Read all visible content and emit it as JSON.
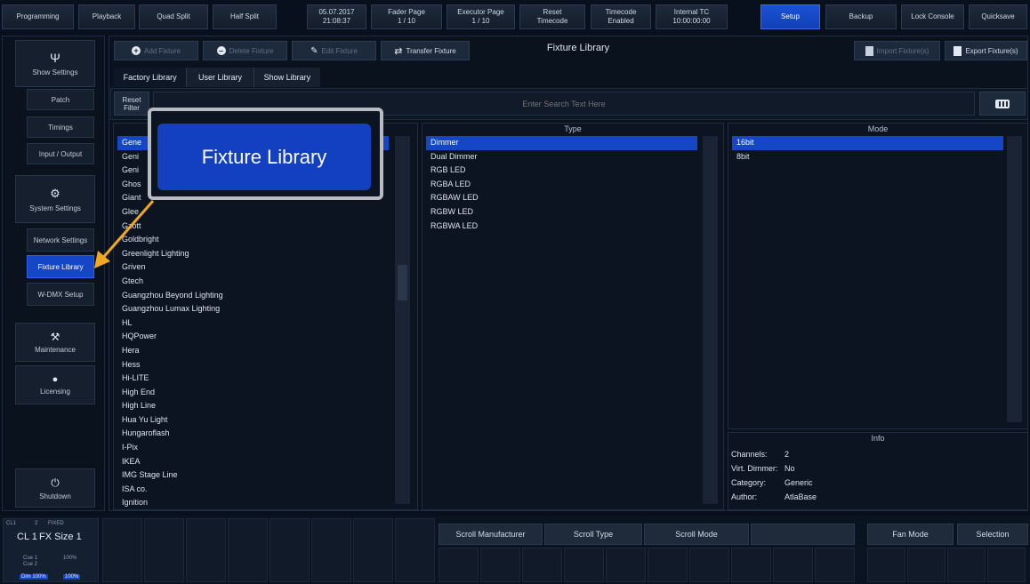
{
  "top_bar": {
    "programming": "Programming",
    "playback": "Playback",
    "quad_split": "Quad Split",
    "half_split": "Half Split",
    "date": "05.07.2017",
    "time": "21:08:37",
    "fader_page_label": "Fader Page",
    "fader_page_value": "1 / 10",
    "executor_page_label": "Executor Page",
    "executor_page_value": "1 / 10",
    "reset_label": "Reset",
    "reset_sub": "Timecode",
    "timecode_label": "Timecode",
    "timecode_sub": "Enabled",
    "internal_tc_label": "Internal TC",
    "internal_tc_value": "10:00:00:00",
    "setup": "Setup",
    "backup": "Backup",
    "lock_console": "Lock Console",
    "quicksave": "Quicksave"
  },
  "sidebar": {
    "show_settings": "Show Settings",
    "patch": "Patch",
    "timings": "Timings",
    "input_output": "Input / Output",
    "system_settings": "System Settings",
    "network_settings": "Network Settings",
    "fixture_library": "Fixture Library",
    "wdmx_setup": "W-DMX Setup",
    "maintenance": "Maintenance",
    "licensing": "Licensing",
    "shutdown": "Shutdown"
  },
  "toolbar": {
    "add_fixture": "Add Fixture",
    "delete_fixture": "Delete Fixture",
    "edit_fixture": "Edit Fixture",
    "transfer_fixture": "Transfer Fixture",
    "title": "Fixture Library",
    "import_fixtures": "Import Fixture(s)",
    "export_fixtures": "Export Fixture(s)"
  },
  "tabs": [
    "Factory Library",
    "User Library",
    "Show Library"
  ],
  "search": {
    "reset_filter_line1": "Reset",
    "reset_filter_line2": "Filter",
    "placeholder": "Enter Search Text Here"
  },
  "callout": {
    "label": "Fixture Library"
  },
  "manufacturers": [
    "Gene",
    "Geni",
    "Geni",
    "Ghos",
    "Giant",
    "Glee",
    "Gzott",
    "Goldbright",
    "Greenlight Lighting",
    "Griven",
    "Gtech",
    "Guangzhou Beyond Lighting",
    "Guangzhou Lumax Lighting",
    "HL",
    "HQPower",
    "Hera",
    "Hess",
    "Hi-LITE",
    "High End",
    "High Line",
    "Hua Yu Light",
    "Hungaroflash",
    "I-Pix",
    "IKEA",
    "IMG Stage Line",
    "ISA co.",
    "Ignition"
  ],
  "type": {
    "header": "Type",
    "items": [
      "Dimmer",
      "Dual Dimmer",
      "RGB LED",
      "RGBA LED",
      "RGBAW LED",
      "RGBW LED",
      "RGBWA LED"
    ]
  },
  "mode": {
    "header": "Mode",
    "items": [
      "16bit",
      "8bit"
    ]
  },
  "info": {
    "header": "Info",
    "channels_label": "Channels:",
    "channels_value": "2",
    "virt_dimmer_label": "Virt. Dimmer:",
    "virt_dimmer_value": "No",
    "category_label": "Category:",
    "category_value": "Generic",
    "author_label": "Author:",
    "author_value": "AtlaBase"
  },
  "bottom": {
    "cue_small": "CL1",
    "cue_num": "2",
    "fixed": "FIXED",
    "cl_label": "CL 1",
    "fx_size": "FX Size 1",
    "cue1": "Cue 1",
    "cue2": "Cue 2",
    "pct1": "100%",
    "dim": "Dim 100%",
    "pct2": "100%",
    "scroll_manufacturer": "Scroll Manufacturer",
    "scroll_type": "Scroll Type",
    "scroll_mode": "Scroll Mode",
    "fan_mode": "Fan Mode",
    "selection": "Selection"
  }
}
